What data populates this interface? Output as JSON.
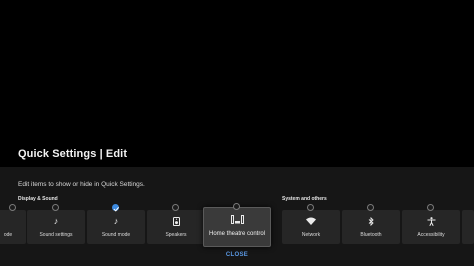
{
  "header": {
    "title": "Quick Settings | Edit"
  },
  "description": "Edit items to show or hide in Quick Settings.",
  "sections": {
    "display_sound": {
      "label": "Display & Sound"
    },
    "system_others": {
      "label": "System and others"
    }
  },
  "tiles": [
    {
      "label": "ode",
      "icon": "picture-mode-icon",
      "checked": false
    },
    {
      "label": "Sound settings",
      "icon": "music-note-icon",
      "checked": false
    },
    {
      "label": "Sound mode",
      "icon": "music-note-icon",
      "checked": true
    },
    {
      "label": "Speakers",
      "icon": "speaker-icon",
      "checked": false
    },
    {
      "label": "Home theatre control",
      "icon": "home-theatre-icon",
      "checked": false,
      "focused": true
    },
    {
      "label": "Network",
      "icon": "wifi-icon",
      "checked": false
    },
    {
      "label": "Bluetooth",
      "icon": "bluetooth-icon",
      "checked": false
    },
    {
      "label": "Accessibility",
      "icon": "accessibility-icon",
      "checked": false
    }
  ],
  "footer": {
    "close_label": "CLOSE"
  },
  "colors": {
    "accent": "#3d8ae0",
    "link": "#5b9ae6",
    "panel": "#161616",
    "tile": "#262626"
  }
}
